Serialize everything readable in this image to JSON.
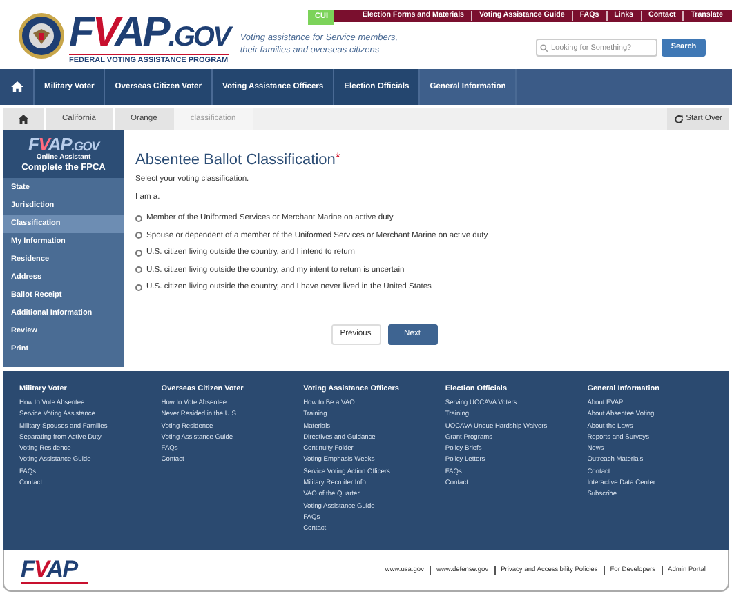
{
  "header": {
    "logo": {
      "parts": [
        "F",
        "V",
        "AP",
        ".GOV"
      ],
      "tagline": "FEDERAL VOTING ASSISTANCE PROGRAM"
    },
    "slogan": [
      "Voting assistance for Service members,",
      "their families and overseas citizens"
    ],
    "cui": "CUI",
    "top_links": [
      "Election Forms and Materials",
      "Voting Assistance Guide",
      "FAQs",
      "Links",
      "Contact",
      "Translate"
    ],
    "search": {
      "placeholder": "Looking for Something?",
      "button": "Search"
    }
  },
  "nav": [
    {
      "label": "Military Voter",
      "selected": false
    },
    {
      "label": "Overseas Citizen Voter",
      "selected": false
    },
    {
      "label": "Voting Assistance Officers",
      "selected": false
    },
    {
      "label": "Election Officials",
      "selected": false
    },
    {
      "label": "General Information",
      "selected": true
    }
  ],
  "breadcrumb": [
    {
      "label": "California",
      "current": false
    },
    {
      "label": "Orange",
      "current": false
    },
    {
      "label": "classification",
      "current": true
    }
  ],
  "start_over": "Start Over",
  "sidebar": {
    "logo": {
      "parts": [
        "F",
        "V",
        "AP",
        ".GOV"
      ]
    },
    "subtitle": "Online Assistant",
    "title": "Complete the FPCA",
    "items": [
      {
        "label": "State",
        "selected": false
      },
      {
        "label": "Jurisdiction",
        "selected": false
      },
      {
        "label": "Classification",
        "selected": true
      },
      {
        "label": "My Information",
        "selected": false
      },
      {
        "label": "Residence",
        "selected": false
      },
      {
        "label": "Address",
        "selected": false
      },
      {
        "label": "Ballot Receipt",
        "selected": false
      },
      {
        "label": "Additional Information",
        "selected": false
      },
      {
        "label": "Review",
        "selected": false
      },
      {
        "label": "Print",
        "selected": false
      }
    ]
  },
  "form": {
    "title": "Absentee Ballot Classification",
    "required_mark": "*",
    "instruction": "Select your voting classification.",
    "prompt": "I am a:",
    "options": [
      {
        "label": "Member of the Uniformed Services or Merchant Marine on active duty",
        "selected": false
      },
      {
        "label": "Spouse or dependent of a member of the Uniformed Services or Merchant Marine on active duty",
        "selected": false
      },
      {
        "label": "U.S. citizen living outside the country, and I intend to return",
        "selected": false
      },
      {
        "label": "U.S. citizen living outside the country, and my intent to return is uncertain",
        "selected": false
      },
      {
        "label": "U.S. citizen living outside the country, and I have never lived in the United States",
        "selected": false
      }
    ],
    "buttons": [
      {
        "label": "Previous",
        "kind": "secondary"
      },
      {
        "label": "Next",
        "kind": "primary"
      }
    ]
  },
  "footer": {
    "columns": [
      {
        "title": "Military Voter",
        "links": [
          "How to Vote Absentee",
          "Service Voting Assistance",
          "Military Spouses and Families",
          "Separating from Active Duty",
          "Voting Residence",
          "Voting Assistance Guide",
          "FAQs",
          "Contact"
        ]
      },
      {
        "title": "Overseas Citizen Voter",
        "links": [
          "How to Vote Absentee",
          "Never Resided in the U.S.",
          "Voting Residence",
          "Voting Assistance Guide",
          "FAQs",
          "Contact"
        ]
      },
      {
        "title": "Voting Assistance Officers",
        "links": [
          "How to Be a VAO",
          "Training",
          "Materials",
          "Directives and Guidance",
          "Continuity Folder",
          "Voting Emphasis Weeks",
          "Service Voting Action Officers",
          "Military Recruiter Info",
          "VAO of the Quarter",
          "Voting Assistance Guide",
          "FAQs",
          "Contact"
        ]
      },
      {
        "title": "Election Officials",
        "links": [
          "Serving UOCAVA Voters",
          "Training",
          "UOCAVA Undue Hardship Waivers",
          "Grant Programs",
          "Policy Briefs",
          "Policy Letters",
          "FAQs",
          "Contact"
        ]
      },
      {
        "title": "General Information",
        "links": [
          "About FVAP",
          "About Absentee Voting",
          "About the Laws",
          "Reports and Surveys",
          "News",
          "Outreach Materials",
          "Contact",
          "Interactive Data Center",
          "Subscribe"
        ]
      }
    ],
    "logo": {
      "parts": [
        "F",
        "V",
        "AP"
      ]
    },
    "links": [
      "www.usa.gov",
      "www.defense.gov",
      "Privacy and Accessibility Policies",
      "For Developers",
      "Admin Portal"
    ]
  }
}
